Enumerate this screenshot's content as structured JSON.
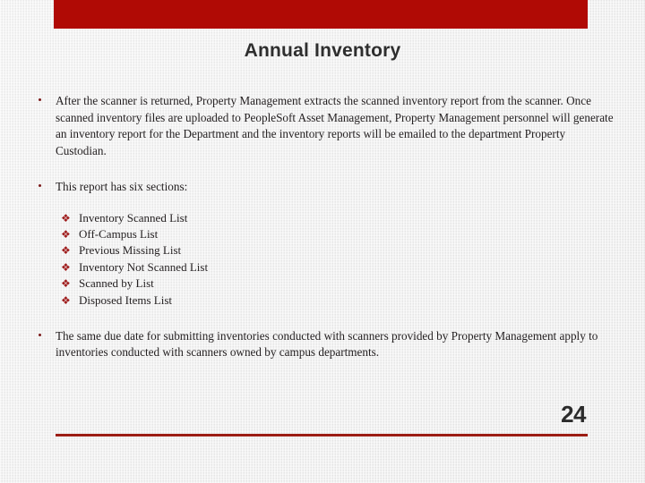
{
  "slide": {
    "title": "Annual Inventory",
    "page_number": "24",
    "accent_color": "#b00a05",
    "rule_color": "#9c1d14",
    "background_color": "#eeeeee",
    "text_color": "#231f20"
  },
  "bullets": [
    {
      "marker": "bullet-dot",
      "text": "After the scanner is returned, Property Management extracts the scanned inventory report from the scanner. Once scanned inventory files are uploaded to PeopleSoft Asset Management, Property Management personnel will generate an inventory report for the Department and the inventory reports will be emailed to the department Property Custodian."
    },
    {
      "marker": "bullet-dot",
      "text": "This report has six sections:"
    },
    {
      "marker": "bullet-dot",
      "text": "The same due date for submitting inventories conducted with scanners provided by Property Management  apply to inventories conducted with scanners owned by campus departments."
    }
  ],
  "sub_list": {
    "marker_glyph": "❖",
    "marker_color": "#9e1b1b",
    "items": [
      {
        "label": "Inventory Scanned List"
      },
      {
        "label": "Off-Campus List"
      },
      {
        "label": "Previous Missing List"
      },
      {
        "label": "Inventory Not Scanned List"
      },
      {
        "label": "Scanned by List"
      },
      {
        "label": "Disposed Items List"
      }
    ]
  }
}
